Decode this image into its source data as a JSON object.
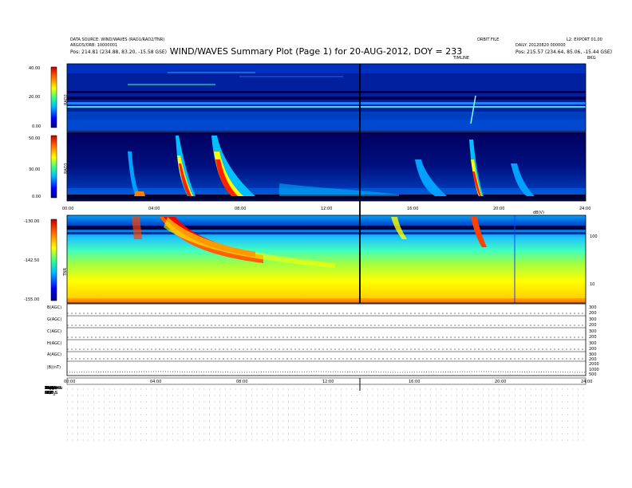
{
  "header": {
    "left_line1": "DATA SOURCE: WIND/WAVES (RAD1/RAD2/TNR)",
    "left_line2": "ARGOS/ORB: 10000001",
    "left_pos": "Pos: 214.81 (234.88, 83.20, -15.58 GSE)",
    "right_line1": "ORBIT FILE",
    "right_line2": "DAILY: 20120820 000000",
    "right_pos": "Pos: 215.57 (234.64, 85.06, -15.44 GSE)",
    "right_corner": "L2: EXPORT 01.00",
    "title": "WIND/WAVES Summary Plot (Page 1) for 20-AUG-2012, DOY = 233",
    "top_right_tag": "TIMLINE",
    "top_right_tag2": "BKG"
  },
  "panels": {
    "rad2_label": "RAD2",
    "rad1_label": "RAD1",
    "tnr_label": "TNR",
    "tnr_axis_label": "dB(V)",
    "rad2_yticks": [
      "40.00",
      "20.00",
      "0.00"
    ],
    "rad1_yticks": [
      "50.00",
      "30.00",
      "0.00"
    ],
    "tnr_yticks": [
      "-130.00",
      "-142.50",
      "-155.00"
    ],
    "tnr_right_ticks": [
      "100",
      "10"
    ],
    "time_ticks": [
      "00:00",
      "04:00",
      "08:00",
      "12:00",
      "16:00",
      "20:00",
      "24:00"
    ],
    "lower_time_ticks": [
      "00:00",
      "04:00",
      "08:00",
      "12:00",
      "16:00",
      "20:00",
      "24:00"
    ]
  },
  "params": [
    {
      "label": "B(AGC)",
      "values": [
        "300",
        "200"
      ]
    },
    {
      "label": "G(AGC)",
      "values": [
        "300",
        "200"
      ]
    },
    {
      "label": "C(AGC)",
      "values": [
        "300",
        "200"
      ]
    },
    {
      "label": "H(AGC)",
      "values": [
        "300",
        "200"
      ]
    },
    {
      "label": "A(AGC)",
      "values": [
        "300",
        "200"
      ]
    },
    {
      "label": "|B|(nT)",
      "values": [
        "2000",
        "1000",
        "500"
      ]
    }
  ],
  "footer": [
    "RAD2",
    "Antenna:     Ex",
    "Mode:    LIST_S",
    "SUM/DIF:   SUM",
    "Toggle:     OFF",
    "RAD1",
    "Antenna:     Ex",
    "Mode:    LIST_S",
    "SUM/DIF:  SUM",
    "Toggle:     OFF",
    "TNR",
    "Antenna:   Ex/Ey",
    "Mode:        ACE",
    "Sweep:      ACE"
  ],
  "colors": {
    "bg": "#0020a0",
    "cold": "#000080",
    "hot": "#ff2000",
    "grid": "#000000"
  }
}
